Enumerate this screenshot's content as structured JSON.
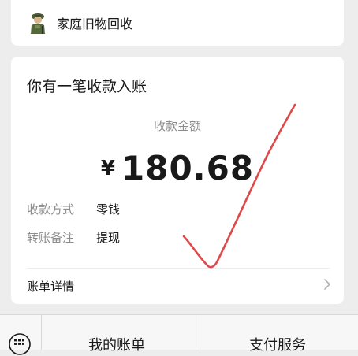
{
  "sender": {
    "name": "家庭旧物回收",
    "avatar_icon": "soldier-avatar-icon"
  },
  "notice": {
    "title": "你有一笔收款入账",
    "amount_label": "收款金额",
    "currency_symbol": "¥",
    "amount": "180.68",
    "details": [
      {
        "key": "收款方式",
        "value": "零钱"
      },
      {
        "key": "转账备注",
        "value": "提现"
      }
    ],
    "bill_detail_label": "账单详情"
  },
  "bottom_menu": {
    "items": [
      "我的账单",
      "支付服务"
    ]
  },
  "colors": {
    "checkmark": "#e0484a",
    "background": "#ededed",
    "card": "#ffffff",
    "muted_text": "#8c8c8c"
  },
  "icons": {
    "keyboard": "keyboard-icon",
    "chevron": "chevron-right-icon",
    "annotation": "checkmark-annotation"
  }
}
